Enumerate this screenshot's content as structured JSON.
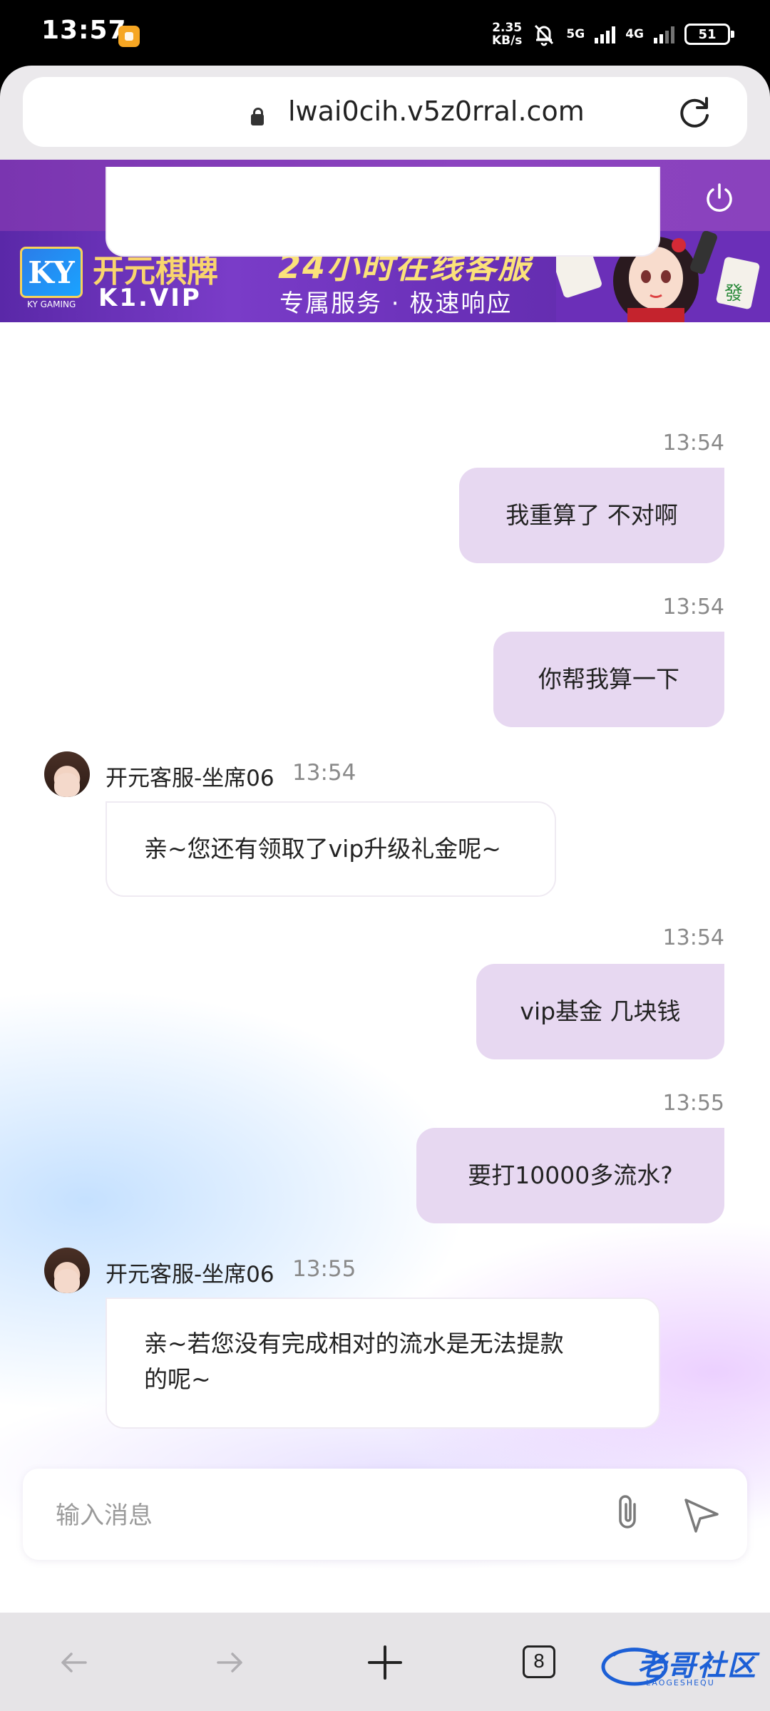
{
  "status_bar": {
    "time": "13:57",
    "net_speed_value": "2.35",
    "net_speed_unit": "KB/s",
    "net1": "5G",
    "net2": "4G",
    "battery": "51"
  },
  "browser": {
    "url": "lwai0cih.v5z0rral.com",
    "tabs_count": "8"
  },
  "banner": {
    "logo": "KY",
    "logo_sub": "KY GAMING",
    "brand_name": "开元棋牌",
    "brand_url": "K1.VIP",
    "title": "24小时在线客服",
    "subtitle": "专属服务 · 极速响应"
  },
  "messages": [
    {
      "time": "13:54",
      "text": "我重算了 不对啊"
    },
    {
      "time": "13:54",
      "text": "你帮我算一下"
    },
    {
      "agent": "开元客服-坐席06",
      "time": "13:54",
      "text": "亲~您还有领取了vip升级礼金呢~"
    },
    {
      "time": "13:54",
      "text": "vip基金 几块钱"
    },
    {
      "time": "13:55",
      "text": "要打10000多流水?"
    },
    {
      "agent": "开元客服-坐席06",
      "time": "13:55",
      "text_line1": "亲~若您没有完成相对的流水是无法提款",
      "text_line2": "的呢~"
    }
  ],
  "composer": {
    "placeholder": "输入消息"
  },
  "watermark": {
    "text": "老哥社区",
    "sub": "LAOGESHEQU"
  },
  "colors": {
    "header": "#7a35b0",
    "outgoing_bubble": "#e7d8f1",
    "incoming_bubble": "#ffffff"
  }
}
